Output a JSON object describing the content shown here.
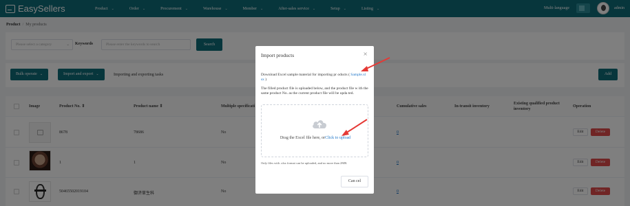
{
  "app": {
    "logo_text": "EasySellers"
  },
  "nav": {
    "items": [
      {
        "label": "Product"
      },
      {
        "label": "Order"
      },
      {
        "label": "Procurement"
      },
      {
        "label": "Warehouse"
      },
      {
        "label": "Member"
      },
      {
        "label": "After-sales service"
      },
      {
        "label": "Setup"
      },
      {
        "label": "Listing"
      }
    ],
    "language": "Multi-language",
    "user": "admin"
  },
  "breadcrumb": {
    "root": "Product",
    "current": "My products"
  },
  "filter": {
    "category_placeholder": "Please select a category",
    "keywords_label": "Keywords",
    "keywords_placeholder": "Please enter the keywords to search",
    "search_label": "Search"
  },
  "toolbar": {
    "bulk_label": "Bulk operate",
    "import_export_label": "Import and export",
    "tasks_label": "Importing and exporting tasks",
    "add_label": "Add"
  },
  "table": {
    "headers": {
      "image": "Image",
      "product_no": "Product No. ⇕",
      "product_name": "Product name ⇕",
      "multiple_spec": "Multiple specificati",
      "cumulative_sales": "Cumulative sales",
      "in_transit": "In-transit inventory",
      "existing_qualified": "Existing qualified product inventory",
      "operation": "Operation"
    },
    "rows": [
      {
        "product_no": "8678",
        "product_name": "78686",
        "multiple_spec": "No",
        "cumulative_sales": "0",
        "edit": "Edit",
        "delete": "Delete"
      },
      {
        "product_no": "1",
        "product_name": "1",
        "multiple_spec": "No",
        "cumulative_sales": "0",
        "edit": "Edit",
        "delete": "Delete"
      },
      {
        "product_no": "50465502019104",
        "product_name": "御济草生科",
        "multiple_spec": "No",
        "cumulative_sales": "0",
        "edit": "Edit",
        "delete": "Delete"
      }
    ]
  },
  "dialog": {
    "title": "Import products",
    "close": "×",
    "download_text": "Download Excel sample material for importing pr oducts (",
    "sample_link": "Sample.xl sx",
    "close_paren": ")",
    "upload_note": "The filled product file is uploaded below, and the product file w ith the same product No. as the current product file will be upda ted.",
    "drop_text": "Drag the Excel file here, or",
    "click_upload": "Click to upload",
    "tip": "Only files with .xlsx format can be uploaded, and no more than 2MB.",
    "cancel_label": "Can cel"
  },
  "colors": {
    "brand": "#0e6c79",
    "link": "#1a73c7",
    "danger": "#e04b4b",
    "annotation_arrow": "#e53935"
  }
}
